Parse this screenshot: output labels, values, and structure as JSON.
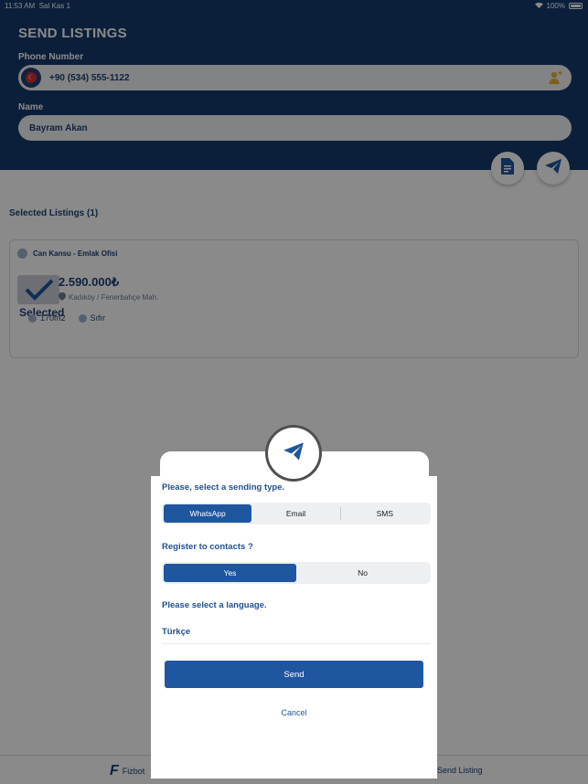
{
  "status_bar": {
    "time": "11:53 AM",
    "date": "Sal Kas 1",
    "battery": "100%"
  },
  "header": {
    "title": "SEND LISTINGS",
    "phone_label": "Phone Number",
    "phone_value": "+90 (534) 555-1122",
    "name_label": "Name",
    "name_value": "Bayram Akan"
  },
  "main": {
    "section_title": "Selected Listings (1)",
    "listing": {
      "agent": "Can Kansu - Emlak Ofisi",
      "price": "2.590.000₺",
      "location": "Kadıköy / Fenerbahçe Mah.",
      "selected_label": "Selected",
      "area": "170m2",
      "condition": "Sıfır"
    }
  },
  "tabbar": {
    "left_label": "Fizbot",
    "right_label": "Send Listing"
  },
  "modal": {
    "sending_type_label": "Please, select a sending type.",
    "sending_types": [
      "WhatsApp",
      "Email",
      "SMS"
    ],
    "selected_sending_type": "WhatsApp",
    "register_label": "Register to contacts ?",
    "register_options": [
      "Yes",
      "No"
    ],
    "selected_register": "Yes",
    "language_label": "Please select a language.",
    "language_value": "Türkçe",
    "send_button": "Send",
    "cancel_button": "Cancel"
  },
  "colors": {
    "primary": "#163a6e",
    "accent": "#1f56a0",
    "text": "#1f3f73"
  }
}
